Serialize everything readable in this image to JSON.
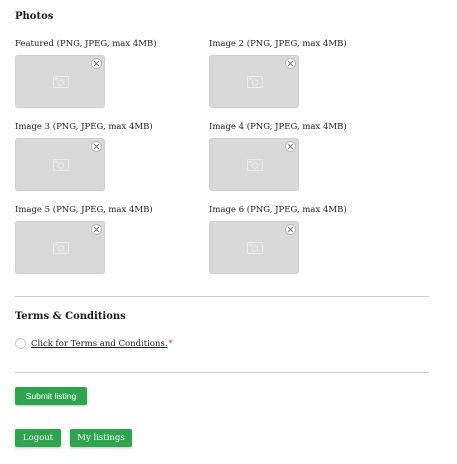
{
  "photos": {
    "title": "Photos",
    "items": [
      {
        "label": "Featured (PNG, JPEG, max 4MB)"
      },
      {
        "label": "Image 2 (PNG, JPEG, max 4MB)"
      },
      {
        "label": "Image 3 (PNG, JPEG, max 4MB)"
      },
      {
        "label": "Image 4 (PNG, JPEG, max 4MB)"
      },
      {
        "label": "Image 5 (PNG, JPEG, max 4MB)"
      },
      {
        "label": "Image 6 (PNG, JPEG, max 4MB)"
      }
    ],
    "placeholder_icon": "image-icon",
    "remove_icon": "close-icon"
  },
  "terms": {
    "title": "Terms & Conditions",
    "link_text": "Click for Terms and Conditions.",
    "required_mark": "*"
  },
  "actions": {
    "submit_label": "Submit listing",
    "logout_label": "Logout",
    "my_listings_label": "My listings"
  },
  "colors": {
    "button_bg": "#2ea44f",
    "required": "#dd3333",
    "thumb_bg": "#d9d9d9"
  }
}
